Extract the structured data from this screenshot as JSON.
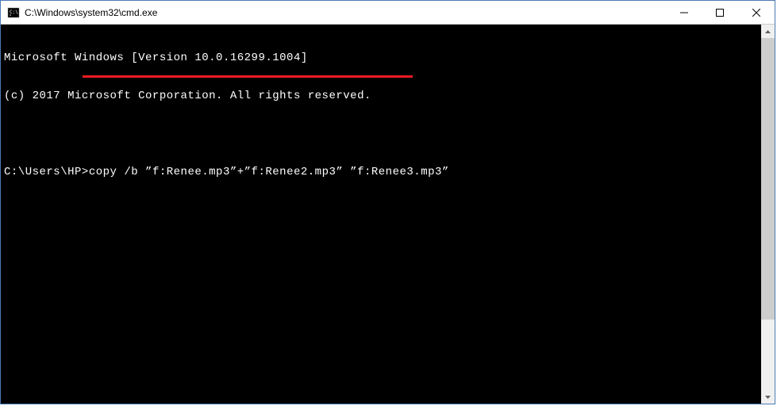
{
  "titlebar": {
    "title": "C:\\Windows\\system32\\cmd.exe"
  },
  "terminal": {
    "line1": "Microsoft Windows [Version 10.0.16299.1004]",
    "line2": "(c) 2017 Microsoft Corporation. All rights reserved.",
    "line3": "",
    "prompt": "C:\\Users\\HP>",
    "command": "copy /b ”f:Renee.mp3”+”f:Renee2.mp3” ”f:Renee3.mp3”"
  }
}
